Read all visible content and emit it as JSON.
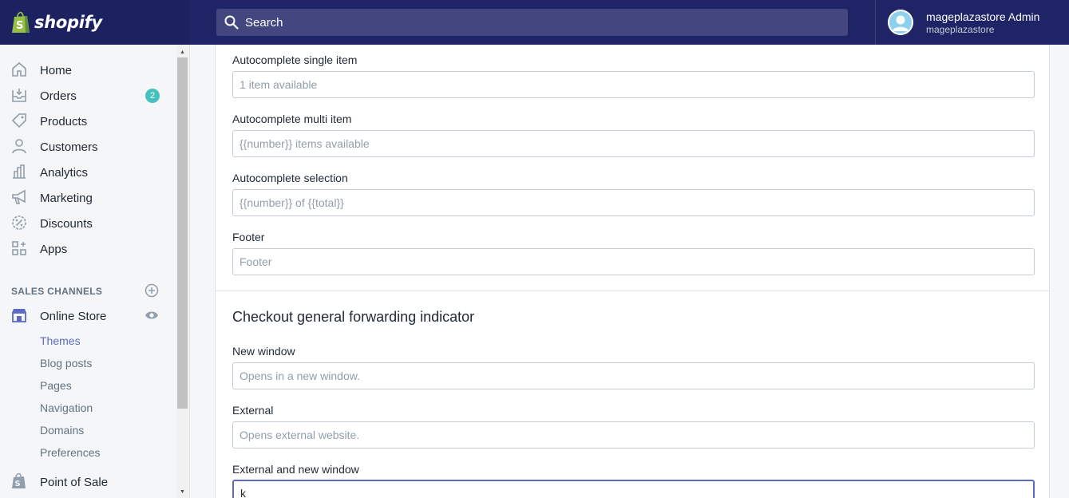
{
  "brand": {
    "name": "shopify"
  },
  "search": {
    "placeholder": "Search"
  },
  "user": {
    "name": "mageplazastore Admin",
    "shop": "mageplazastore"
  },
  "sidebar": {
    "items": [
      {
        "label": "Home",
        "icon": "home-icon"
      },
      {
        "label": "Orders",
        "icon": "orders-icon",
        "badge": "2"
      },
      {
        "label": "Products",
        "icon": "tag-icon"
      },
      {
        "label": "Customers",
        "icon": "person-icon"
      },
      {
        "label": "Analytics",
        "icon": "bar-chart-icon"
      },
      {
        "label": "Marketing",
        "icon": "megaphone-icon"
      },
      {
        "label": "Discounts",
        "icon": "discount-icon"
      },
      {
        "label": "Apps",
        "icon": "apps-icon"
      }
    ],
    "sales_channels_title": "SALES CHANNELS",
    "online_store": {
      "label": "Online Store",
      "subitems": [
        "Themes",
        "Blog posts",
        "Pages",
        "Navigation",
        "Domains",
        "Preferences"
      ],
      "active": "Themes"
    },
    "point_of_sale": "Point of Sale"
  },
  "form": {
    "fields_top": [
      {
        "label": "Autocomplete single item",
        "placeholder": "1 item available"
      },
      {
        "label": "Autocomplete multi item",
        "placeholder": "{{number}} items available"
      },
      {
        "label": "Autocomplete selection",
        "placeholder": "{{number}} of {{total}}"
      },
      {
        "label": "Footer",
        "placeholder": "Footer"
      }
    ],
    "section_title": "Checkout general forwarding indicator",
    "fields_bottom": [
      {
        "label": "New window",
        "placeholder": "Opens in a new window."
      },
      {
        "label": "External",
        "placeholder": "Opens external website."
      },
      {
        "label": "External and new window",
        "value": "k"
      }
    ]
  },
  "colors": {
    "topbar": "#1c2260",
    "accent": "#5c6ac4",
    "badge": "#47c1bf"
  }
}
